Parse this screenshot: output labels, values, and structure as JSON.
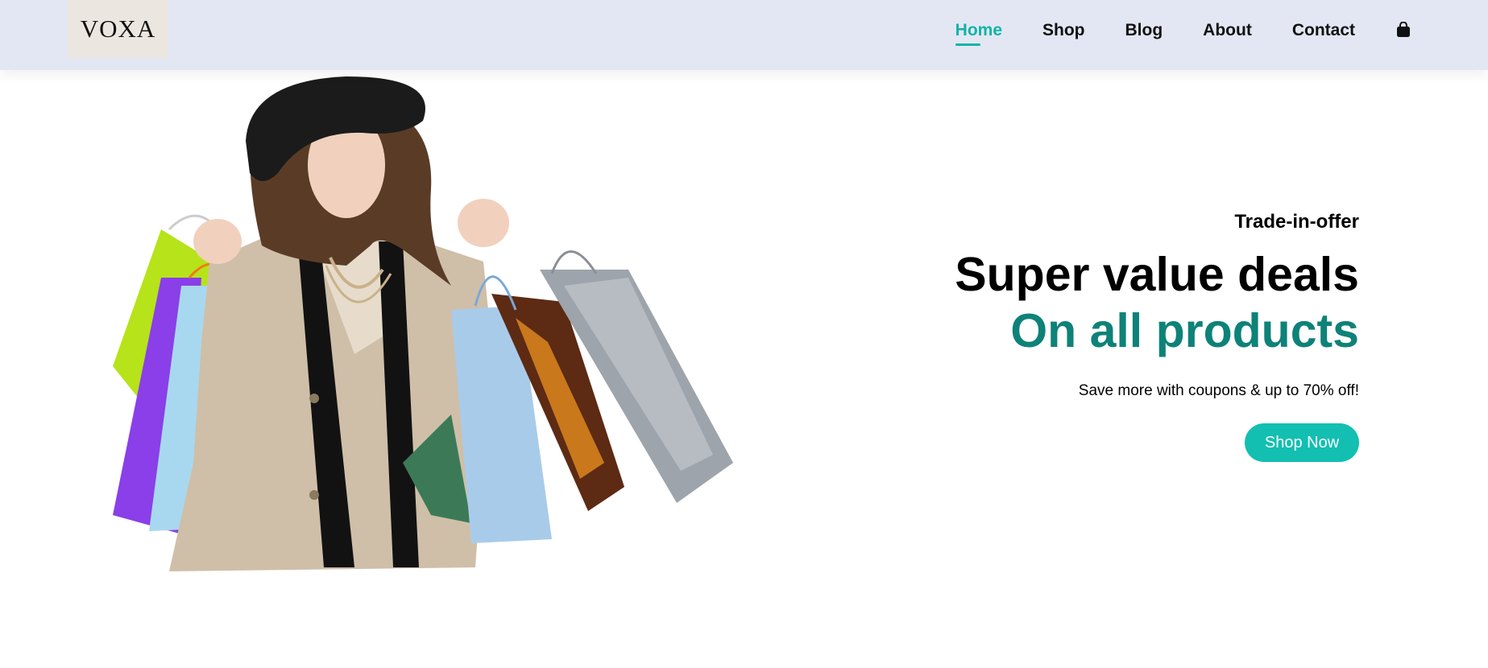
{
  "brand": {
    "logo_text": "VOXA"
  },
  "nav": {
    "items": [
      {
        "label": "Home",
        "active": true
      },
      {
        "label": "Shop",
        "active": false
      },
      {
        "label": "Blog",
        "active": false
      },
      {
        "label": "About",
        "active": false
      },
      {
        "label": "Contact",
        "active": false
      }
    ],
    "cart_icon": "shopping-bag-icon"
  },
  "hero": {
    "kicker": "Trade-in-offer",
    "headline": "Super value deals",
    "subheadline": "On all products",
    "description": "Save more with coupons & up to 70% off!",
    "cta_label": "Shop Now",
    "image_subject": "woman-with-shopping-bags"
  },
  "colors": {
    "header_bg": "#e3e7f3",
    "accent": "#12b3a6",
    "accent_dark": "#0e8278",
    "button": "#12bfb1"
  }
}
